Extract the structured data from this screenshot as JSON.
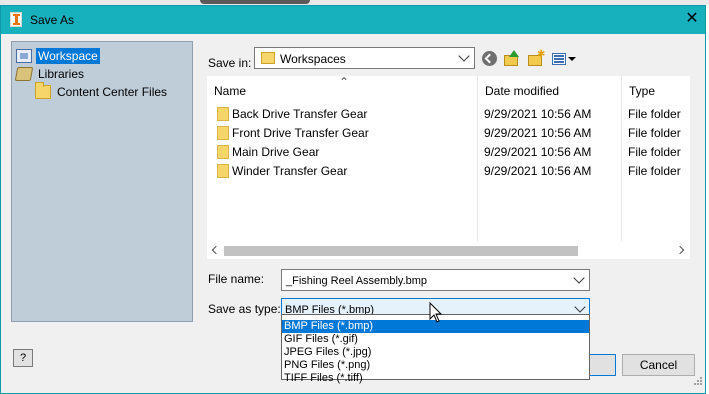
{
  "window": {
    "title": "Save As",
    "close_glyph": "✕"
  },
  "places": [
    {
      "label": "Workspace",
      "icon": "workspace-icon",
      "selected": true
    },
    {
      "label": "Libraries",
      "icon": "libraries-icon",
      "selected": false
    },
    {
      "label": "Content Center Files",
      "icon": "folder-icon",
      "selected": false
    }
  ],
  "save_in": {
    "label": "Save in:",
    "value": "Workspaces"
  },
  "toolbar": {
    "back": "back-icon",
    "up": "up-folder-icon",
    "new_folder": "new-folder-icon",
    "view_menu": "view-menu-icon"
  },
  "files": {
    "columns": [
      "Name",
      "Date modified",
      "Type"
    ],
    "rows": [
      {
        "name": "Back Drive Transfer Gear",
        "date": "9/29/2021 10:56 AM",
        "type": "File folder"
      },
      {
        "name": "Front Drive Transfer Gear",
        "date": "9/29/2021 10:56 AM",
        "type": "File folder"
      },
      {
        "name": "Main Drive Gear",
        "date": "9/29/2021 10:56 AM",
        "type": "File folder"
      },
      {
        "name": "Winder Transfer Gear",
        "date": "9/29/2021 10:56 AM",
        "type": "File folder"
      }
    ]
  },
  "file_name": {
    "label": "File name:",
    "value": "_Fishing Reel Assembly.bmp"
  },
  "save_as_type": {
    "label": "Save as type:",
    "value": "BMP Files (*.bmp)",
    "options": [
      "BMP Files (*.bmp)",
      "GIF Files (*.gif)",
      "JPEG Files (*.jpg)",
      "PNG Files (*.png)",
      "TIFF Files (*.tiff)"
    ],
    "selected_index": 0
  },
  "buttons": {
    "help": "?",
    "cancel": "Cancel"
  },
  "colors": {
    "titlebar": "#17b1bd",
    "selection": "#0078d7",
    "places_bg": "#bfcdd9"
  }
}
